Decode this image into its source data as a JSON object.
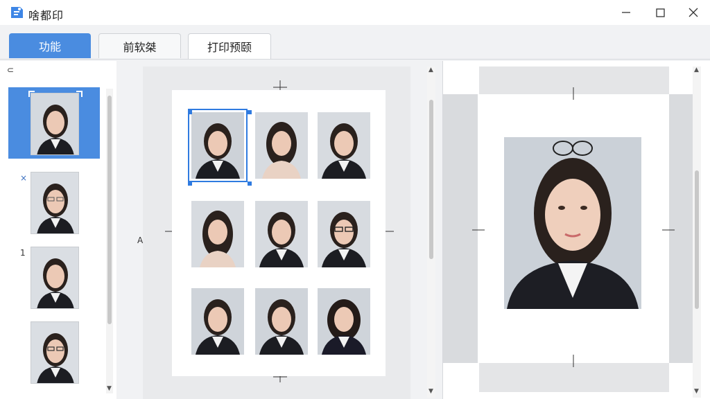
{
  "app": {
    "title": "啥都印",
    "brand_color": "#4a8ce0"
  },
  "tabs": [
    {
      "label": "功能",
      "active": true
    },
    {
      "label": "前软桀",
      "active": false
    },
    {
      "label": "打印预颐",
      "active": false
    }
  ],
  "left_panel": {
    "top_glyph": "⊂",
    "items": [
      {
        "marker": "",
        "selected": true
      },
      {
        "marker": "×",
        "selected": false
      },
      {
        "marker": "1",
        "selected": false
      },
      {
        "marker": "",
        "selected": false
      }
    ]
  },
  "middle": {
    "side_glyph": "A",
    "grid": {
      "rows": 3,
      "cols": 3
    }
  },
  "icons": {
    "logo": "app-logo-icon",
    "minimize": "minimize-icon",
    "maximize": "maximize-icon",
    "close": "close-icon"
  }
}
